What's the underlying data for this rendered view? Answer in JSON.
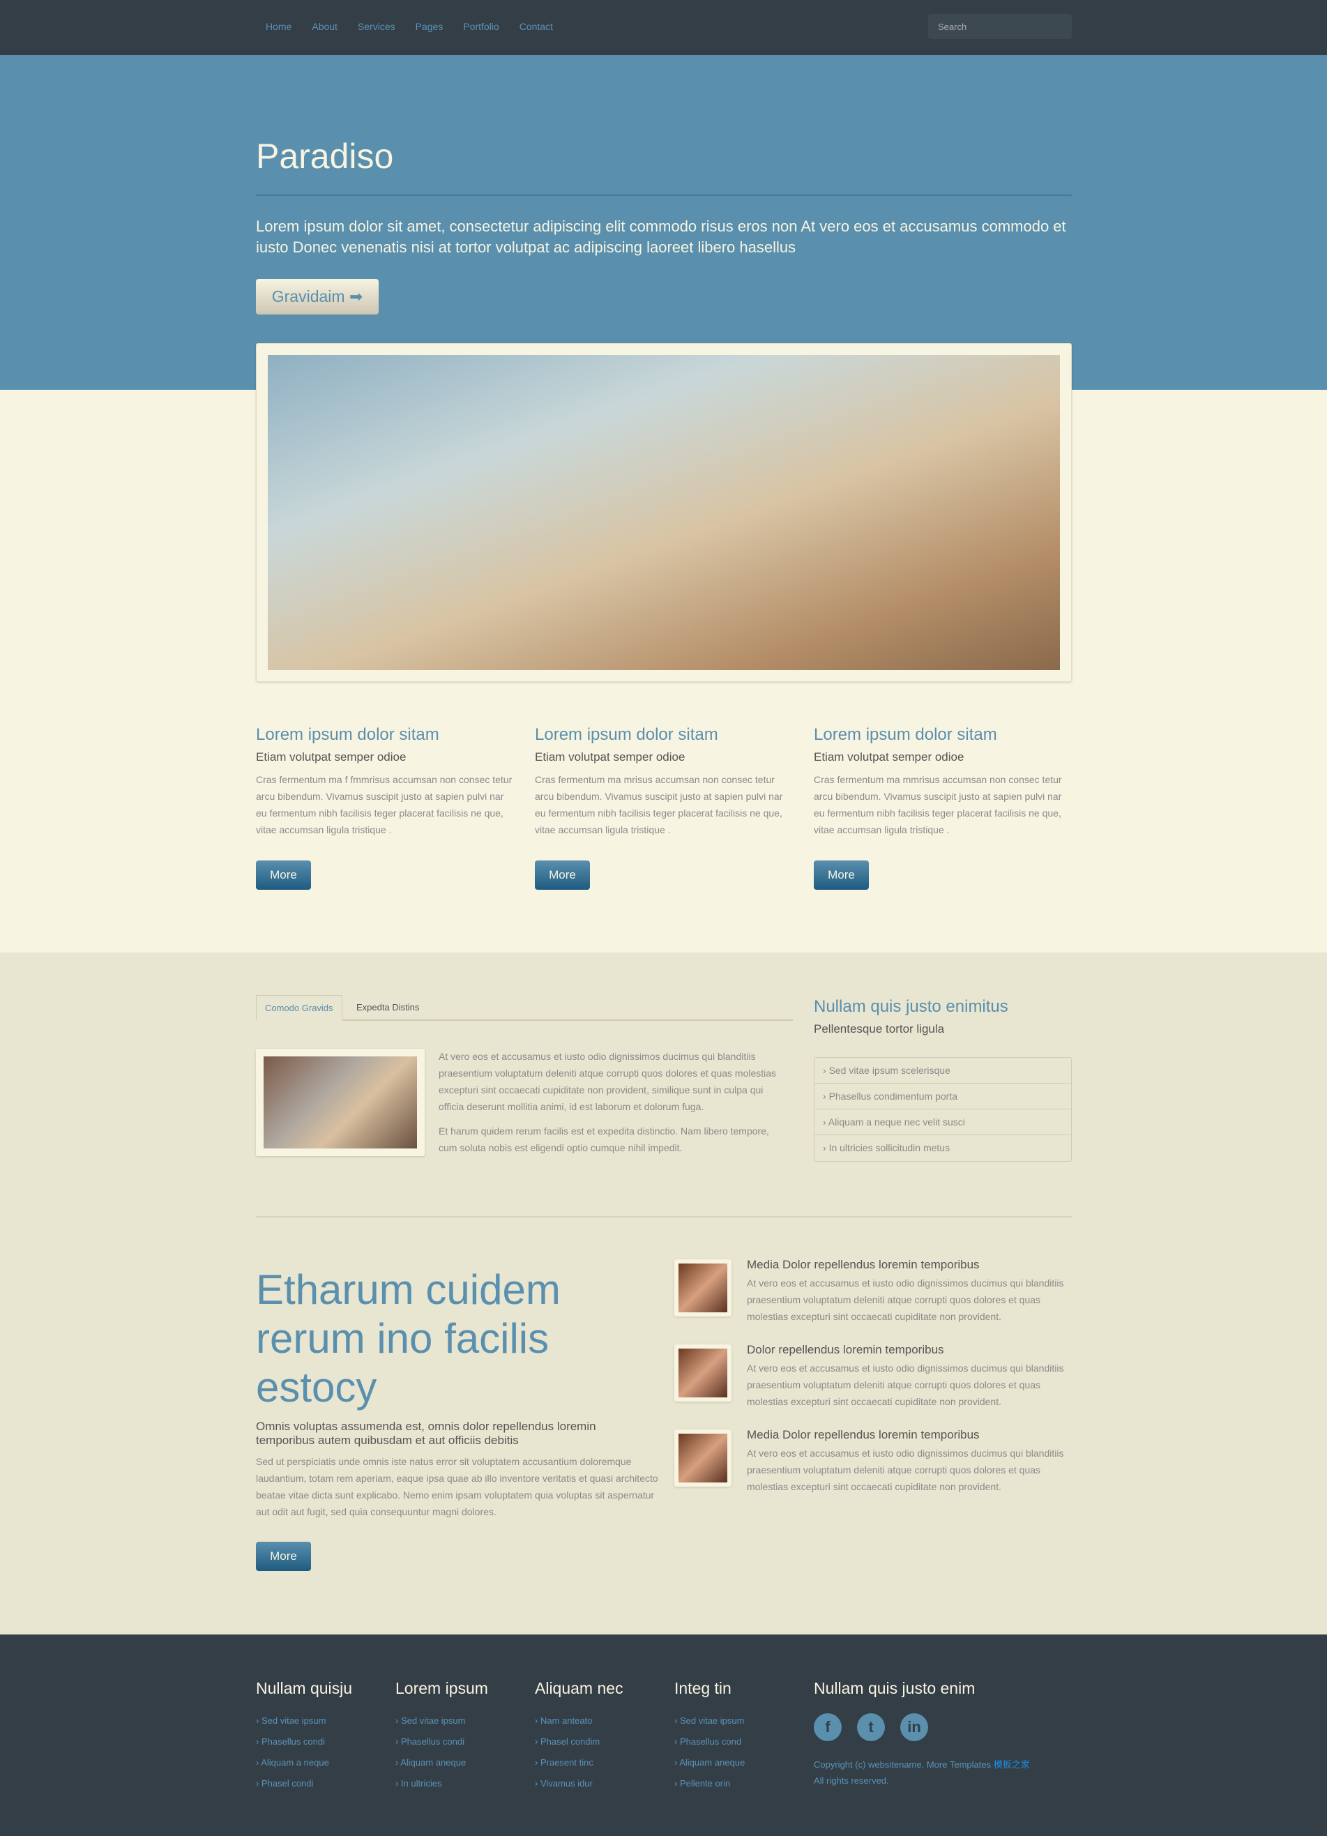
{
  "nav": {
    "items": [
      "Home",
      "About",
      "Services",
      "Pages",
      "Portfolio",
      "Contact"
    ],
    "search_placeholder": "Search"
  },
  "hero": {
    "title": "Paradiso",
    "lead": "Lorem ipsum dolor sit amet, consectetur adipiscing elit commodo risus eros non At vero eos et accusamus commodo et iusto Donec venenatis nisi at tortor volutpat ac adipiscing laoreet libero hasellus",
    "button": "Gravidaim",
    "button_icon": "arrow-right-icon"
  },
  "features": [
    {
      "title": "Lorem ipsum dolor sitam",
      "subtitle": "Etiam volutpat semper odioe",
      "text": "Cras fermentum ma f fmmrisus accumsan non consec tetur arcu bibendum. Vivamus suscipit justo at sapien pulvi nar eu fermentum nibh facilisis teger placerat facilisis ne que, vitae accumsan ligula tristique .",
      "button": "More"
    },
    {
      "title": "Lorem ipsum dolor sitam",
      "subtitle": "Etiam volutpat semper odioe",
      "text": "Cras fermentum ma mrisus accumsan non consec tetur arcu bibendum. Vivamus suscipit justo at sapien pulvi nar eu fermentum nibh facilisis teger placerat facilisis ne que, vitae accumsan ligula tristique .",
      "button": "More"
    },
    {
      "title": "Lorem ipsum dolor sitam",
      "subtitle": "Etiam volutpat semper odioe",
      "text": "Cras fermentum ma mmrisus accumsan non consec tetur arcu bibendum. Vivamus suscipit justo at sapien pulvi nar eu fermentum nibh facilisis teger placerat facilisis ne que, vitae accumsan ligula tristique .",
      "button": "More"
    }
  ],
  "tabs": {
    "items": [
      "Comodo Gravids",
      "Expedta Distins"
    ],
    "active": 0,
    "p1": "At vero eos et accusamus et iusto odio dignissimos ducimus qui blanditiis praesentium voluptatum deleniti atque corrupti quos dolores et quas molestias excepturi sint occaecati cupiditate non provident, similique sunt in culpa qui officia deserunt mollitia animi, id est laborum et dolorum fuga.",
    "p2": "Et harum quidem rerum facilis est et expedita distinctio. Nam libero tempore, cum soluta nobis est eligendi optio cumque nihil impedit."
  },
  "sidebar": {
    "title": "Nullam quis justo enimitus",
    "subtitle": "Pellentesque tortor ligula",
    "items": [
      "Sed vitae ipsum scelerisque",
      "Phasellus condimentum porta",
      "Aliquam a neque nec velit susci",
      "In ultricies sollicitudin metus"
    ]
  },
  "promo": {
    "title": "Etharum cuidem rerum ino facilis estocy",
    "subtitle": "Omnis voluptas assumenda est, omnis dolor repellendus loremin temporibus autem quibusdam et aut officiis debitis",
    "text": "Sed ut perspiciatis unde omnis iste natus error sit voluptatem accusantium doloremque laudantium, totam rem aperiam, eaque ipsa quae ab illo inventore veritatis et quasi architecto beatae vitae dicta sunt explicabo. Nemo enim ipsam voluptatem quia voluptas sit aspernatur aut odit aut fugit, sed quia consequuntur magni dolores.",
    "button": "More"
  },
  "media": [
    {
      "title": "Media Dolor repellendus loremin temporibus",
      "text": "At vero eos et accusamus et iusto odio dignissimos ducimus qui blanditiis praesentium voluptatum deleniti atque corrupti quos dolores et quas molestias excepturi sint occaecati cupiditate non provident."
    },
    {
      "title": "Dolor repellendus loremin temporibus",
      "text": "At vero eos et accusamus et iusto odio dignissimos ducimus qui blanditiis praesentium voluptatum deleniti atque corrupti quos dolores et quas molestias excepturi sint occaecati cupiditate non provident."
    },
    {
      "title": "Media Dolor repellendus loremin temporibus",
      "text": "At vero eos et accusamus et iusto odio dignissimos ducimus qui blanditiis praesentium voluptatum deleniti atque corrupti quos dolores et quas molestias excepturi sint occaecati cupiditate non provident."
    }
  ],
  "footer": {
    "columns": [
      {
        "title": "Nullam quisju",
        "links": [
          "Sed vitae ipsum",
          "Phasellus condi",
          "Aliquam a neque",
          "Phasel condi"
        ]
      },
      {
        "title": "Lorem ipsum",
        "links": [
          "Sed vitae ipsum",
          "Phasellus condi",
          "Aliquam aneque",
          "In ultricies"
        ]
      },
      {
        "title": "Aliquam nec",
        "links": [
          "Nam anteato",
          "Phasel condim",
          "Praesent tinc",
          "Vivamus idur"
        ]
      },
      {
        "title": "Integ tin",
        "links": [
          "Sed vitae ipsum",
          "Phasellus cond",
          "Aliquam aneque",
          "Pellente orin"
        ]
      }
    ],
    "social_title": "Nullam quis justo enim",
    "social": [
      {
        "icon": "facebook-icon",
        "glyph": "f"
      },
      {
        "icon": "twitter-icon",
        "glyph": "t"
      },
      {
        "icon": "linkedin-icon",
        "glyph": "in"
      }
    ],
    "copyright": "Copyright (c) websitename. More Templates",
    "copyright_link": "模板之家",
    "rights": "All rights reserved."
  },
  "colors": {
    "nav": "#343e46",
    "hero": "#5a8fae",
    "cream": "#f7f4e1",
    "section": "#e8e5d0",
    "accent": "#5a8fae"
  }
}
